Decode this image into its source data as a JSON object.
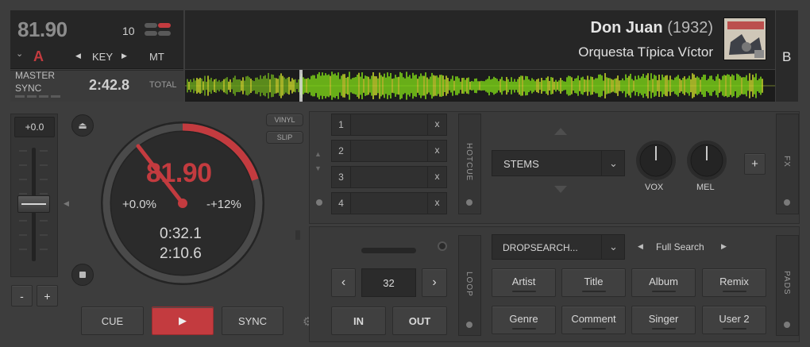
{
  "deck": {
    "bpm": "81.90",
    "pitch_range": "10",
    "key_letter": "A",
    "key_label": "KEY",
    "mt_label": "MT",
    "master_label": "MASTER",
    "sync_label": "SYNC",
    "remaining_time": "2:42.8",
    "total_label": "TOTAL",
    "deck_letter": "B",
    "accent_color": "#c33b3f",
    "waveform_color": "#7bd318"
  },
  "track": {
    "title": "Don Juan",
    "year": "(1932)",
    "artist": "Orquesta Típica Víctor"
  },
  "pitch": {
    "value": "+0.0",
    "minus": "-",
    "plus": "+"
  },
  "jog": {
    "bpm": "81.90",
    "pitch_pct": "+0.0%",
    "pitch_range": "-+12%",
    "elapsed": "0:32.1",
    "remaining": "2:10.6",
    "position": 0.2
  },
  "buttons": {
    "vinyl": "VINYL",
    "slip": "SLIP",
    "cue": "CUE",
    "sync": "SYNC"
  },
  "hotcues": {
    "label": "HOTCUE",
    "items": [
      {
        "num": "1",
        "x": "x"
      },
      {
        "num": "2",
        "x": "x"
      },
      {
        "num": "3",
        "x": "x"
      },
      {
        "num": "4",
        "x": "x"
      }
    ]
  },
  "stems": {
    "select": "STEMS",
    "vox": "VOX",
    "mel": "MEL",
    "add": "+",
    "fx_label": "FX"
  },
  "loop": {
    "label": "LOOP",
    "size": "32",
    "in": "IN",
    "out": "OUT",
    "prev": "‹",
    "next": "›"
  },
  "pads": {
    "label": "PADS",
    "dropdown": "DROPSEARCH...",
    "mode": "Full Search",
    "items": [
      "Artist",
      "Title",
      "Album",
      "Remix",
      "Genre",
      "Comment",
      "Singer",
      "User 2"
    ]
  }
}
